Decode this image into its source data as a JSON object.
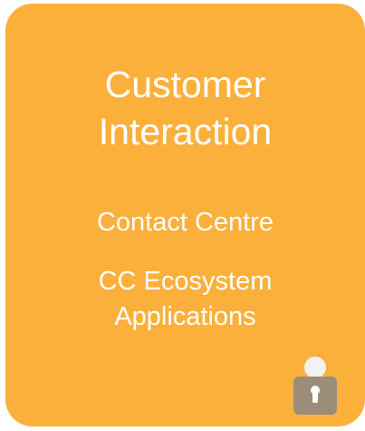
{
  "tile": {
    "title_line1": "Customer",
    "title_line2": "Interaction",
    "links": [
      {
        "label": "Contact Centre"
      },
      {
        "label_line1": "CC Ecosystem",
        "label_line2": "Applications"
      }
    ],
    "lock_icon": "lock-icon"
  },
  "colors": {
    "tile_background": "#fbb03b",
    "text": "#ffffff",
    "lock_body": "#9b8d7a",
    "lock_shackle": "#f2f2f2"
  }
}
